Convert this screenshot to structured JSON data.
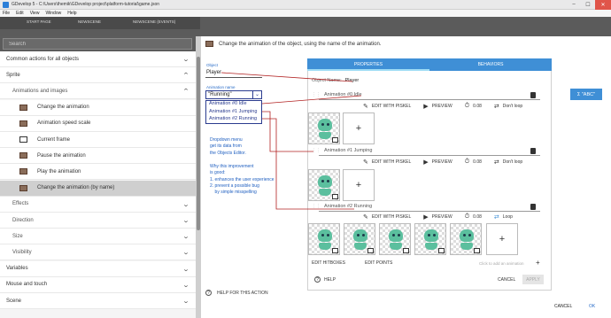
{
  "window": {
    "title": "GDevelop 5 - C:\\Users\\themik\\GDevelop project\\platform-tutorial\\game.json",
    "controls": [
      "–",
      "☐",
      "✕"
    ]
  },
  "menu": [
    "File",
    "Edit",
    "View",
    "Window",
    "Help"
  ],
  "tabs_bg": [
    "START PAGE",
    "NEWSCENE",
    "NEWSCENE (EVENTS)"
  ],
  "left_panel": {
    "search_placeholder": "Search",
    "rows": [
      {
        "kind": "cat",
        "label": "Common actions for all objects",
        "chev": "⌄"
      },
      {
        "kind": "cat",
        "label": "Sprite",
        "chev": "⌃"
      },
      {
        "kind": "sub",
        "label": "Animations and images",
        "chev": "⌃"
      },
      {
        "kind": "item",
        "label": "Change the animation",
        "icon": "film-icon"
      },
      {
        "kind": "item",
        "label": "Animation speed scale",
        "icon": "film-icon"
      },
      {
        "kind": "item",
        "label": "Current frame",
        "icon": "frame-icon"
      },
      {
        "kind": "item",
        "label": "Pause the animation",
        "icon": "film-icon"
      },
      {
        "kind": "item",
        "label": "Play the animation",
        "icon": "film-icon"
      },
      {
        "kind": "item",
        "label": "Change the animation (by name)",
        "icon": "film-icon",
        "selected": true
      },
      {
        "kind": "sub",
        "label": "Effects",
        "chev": "⌄"
      },
      {
        "kind": "sub",
        "label": "Direction",
        "chev": "⌄"
      },
      {
        "kind": "sub",
        "label": "Size",
        "chev": "⌄"
      },
      {
        "kind": "sub",
        "label": "Visibility",
        "chev": "⌄"
      },
      {
        "kind": "cat",
        "label": "Variables",
        "chev": "⌄"
      },
      {
        "kind": "cat",
        "label": "Mouse and touch",
        "chev": "⌄"
      },
      {
        "kind": "cat",
        "label": "Scene",
        "chev": "⌄"
      }
    ]
  },
  "dialog": {
    "header": "Change the animation of the object, using the name of the animation.",
    "object_label": "Object",
    "object_value": "Player",
    "anim_name_label": "Animation name",
    "anim_name_value": "\"Running\"",
    "dropdown_options": [
      "Animation #0 Idle",
      "Animation #1 Jumping",
      "Animation #2 Running"
    ],
    "annotation_1": [
      "Dropdown menu",
      "get its data from",
      "the Objects Editor."
    ],
    "annotation_2": [
      "Why this improvement",
      "is good:",
      "1. enhances the user experience",
      "2. prevent a possible bug",
      "    by simple misspelling"
    ],
    "help": "HELP FOR THIS ACTION",
    "cancel": "CANCEL",
    "ok": "OK",
    "expr_button": "Σ \"ABC\""
  },
  "object_editor": {
    "tabs": [
      "PROPERTIES",
      "BEHAVIORS"
    ],
    "object_name_label": "Object Name:",
    "object_name": "Player",
    "animations": [
      {
        "label": "Animation #0",
        "name": "Idle",
        "frames": 1
      },
      {
        "label": "Animation #1",
        "name": "Jumping",
        "frames": 1
      },
      {
        "label": "Animation #2",
        "name": "Running",
        "frames": 5
      }
    ],
    "controls": [
      {
        "edit": "EDIT WITH PISKEL",
        "preview": "PREVIEW",
        "time": "0.08",
        "loop": "Don't loop"
      },
      {
        "edit": "EDIT WITH PISKEL",
        "preview": "PREVIEW",
        "time": "0.08",
        "loop": "Don't loop"
      },
      {
        "edit": "EDIT WITH PISKEL",
        "preview": "PREVIEW",
        "time": "0.08",
        "loop": "Loop"
      }
    ],
    "edit_hitboxes": "EDIT HITBOXES",
    "edit_points": "EDIT POINTS",
    "add_animation": "Click to add an animation",
    "help": "HELP",
    "cancel": "CANCEL",
    "apply": "APPLY"
  },
  "colors": {
    "accent": "#3f8fd6",
    "annotation": "#1f5fc0",
    "connector": "#b22222",
    "sprite": "#5bbf9e"
  }
}
